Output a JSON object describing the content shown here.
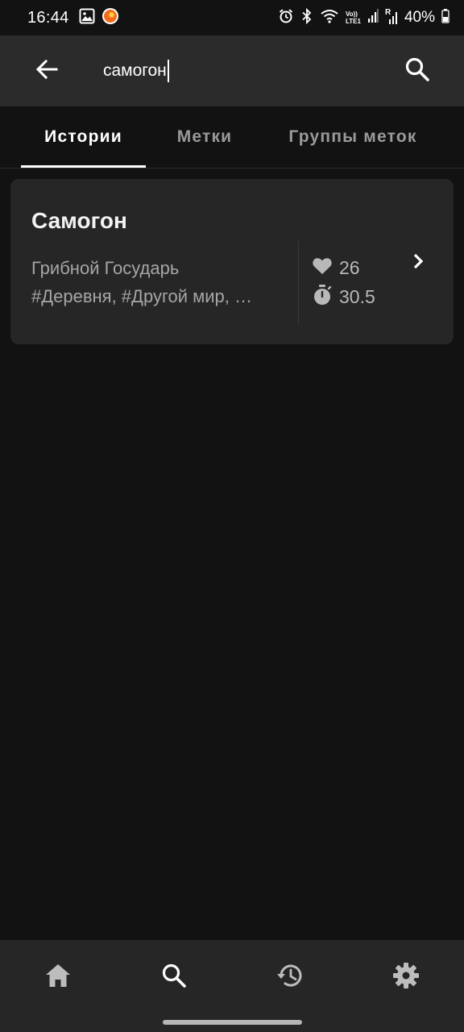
{
  "status_bar": {
    "time": "16:44",
    "battery": "40%",
    "left_icons": [
      "image-icon",
      "app-notification-icon"
    ],
    "right_icons": [
      "alarm-icon",
      "bluetooth-icon",
      "wifi-icon",
      "volte-icon",
      "signal-icon",
      "signal-roaming-icon",
      "battery-icon"
    ],
    "volte_label": "Vo))",
    "lte_label": "LTE1",
    "roaming_label": "R"
  },
  "search": {
    "query": "самогон",
    "back_icon": "arrow-back-icon",
    "search_icon": "search-icon"
  },
  "tabs": [
    {
      "label": "Истории",
      "active": true
    },
    {
      "label": "Метки",
      "active": false
    },
    {
      "label": "Группы меток",
      "active": false
    }
  ],
  "results": [
    {
      "title": "Самогон",
      "author": "Грибной Государь",
      "tags": "#Деревня, #Другой мир, …",
      "likes": "26",
      "reading_time": "30.5"
    }
  ],
  "bottom_nav": [
    {
      "icon": "home-icon",
      "active": false
    },
    {
      "icon": "search-icon",
      "active": true
    },
    {
      "icon": "history-icon",
      "active": false
    },
    {
      "icon": "settings-icon",
      "active": false
    }
  ],
  "colors": {
    "background": "#121212",
    "app_bar": "#2b2b2b",
    "card": "#262626",
    "text_primary": "#ffffff",
    "text_secondary": "#a6a6a6",
    "tab_inactive": "#9a9a9a",
    "nav_icon": "#bdbdbd",
    "nav_icon_active": "#ffffff",
    "status_app_accent": "#f26b1d"
  }
}
